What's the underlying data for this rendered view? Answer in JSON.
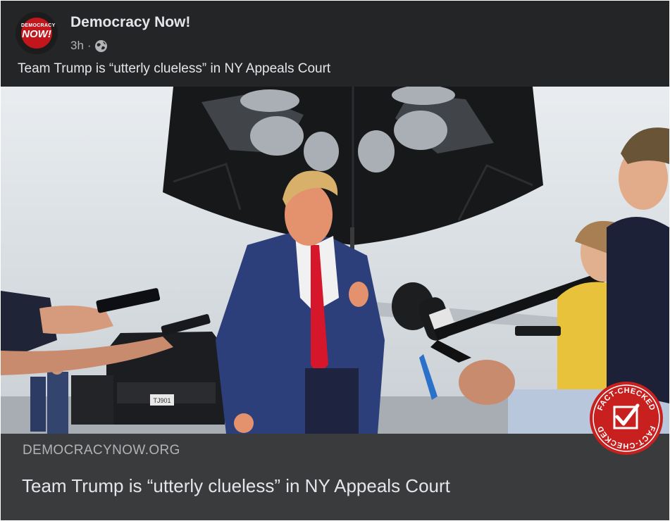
{
  "page": {
    "name": "Democracy Now!",
    "time": "3h",
    "separator": "·"
  },
  "avatar": {
    "logo_top": "DEMOCRACY",
    "logo_main": "NOW!"
  },
  "post": {
    "text": "Team Trump is “utterly clueless” in NY Appeals Court"
  },
  "link": {
    "domain": "DEMOCRACYNOW.ORG",
    "title": "Team Trump is “utterly clueless” in NY Appeals Court"
  },
  "badge": {
    "label_top": "FACT-CHECKED",
    "label_bottom": "FACT-CHECKED"
  },
  "vehicle": {
    "plate": "TJ901"
  },
  "colors": {
    "post_bg": "#242526",
    "footer_bg": "#3a3b3c",
    "text_primary": "#e4e6eb",
    "text_secondary": "#b0b3b8",
    "badge_red": "#c8201f",
    "brand_red": "#c3161c"
  },
  "icons": {
    "privacy": "globe-icon",
    "badge_mark": "checkmark-icon"
  }
}
